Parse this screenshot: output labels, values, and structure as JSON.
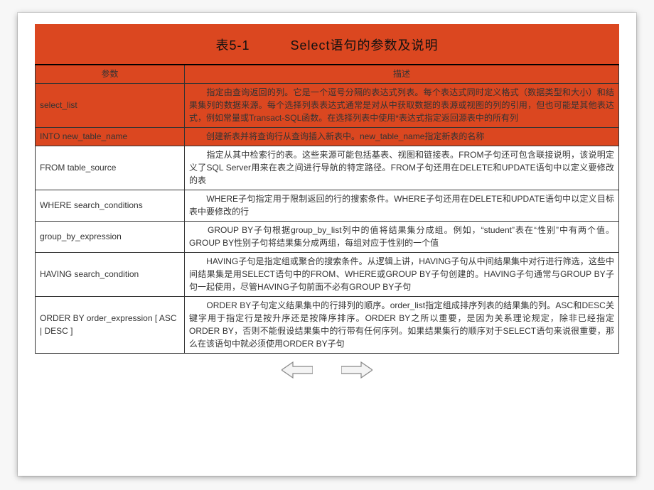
{
  "title": "表5-1　　　Select语句的参数及说明",
  "headers": {
    "param": "参数",
    "desc": "描述"
  },
  "rows": [
    {
      "param": "select_list",
      "orange": true,
      "desc": "　　指定由查询返回的列。它是一个逗号分隔的表达式列表。每个表达式同时定义格式（数据类型和大小）和结果集列的数据来源。每个选择列表表达式通常是对从中获取数据的表源或视图的列的引用，但也可能是其他表达式，例如常量或Transact-SQL函数。在选择列表中使用*表达式指定返回源表中的所有列"
    },
    {
      "param": "INTO new_table_name",
      "orange": true,
      "desc": "　　创建新表并将查询行从查询插入新表中。new_table_name指定新表的名称"
    },
    {
      "param": "FROM table_source",
      "orange": false,
      "desc": "　　指定从其中检索行的表。这些来源可能包括基表、视图和链接表。FROM子句还可包含联接说明，该说明定义了SQL Server用来在表之间进行导航的特定路径。FROM子句还用在DELETE和UPDATE语句中以定义要修改的表"
    },
    {
      "param": "WHERE  search_conditions",
      "orange": false,
      "desc": "　　WHERE子句指定用于限制返回的行的搜索条件。WHERE子句还用在DELETE和UPDATE语句中以定义目标表中要修改的行"
    },
    {
      "param": "group_by_expression",
      "orange": false,
      "desc": "　　GROUP BY子句根据group_by_list列中的值将结果集分成组。例如，“student”表在“性别”中有两个值。GROUP BY性别子句将结果集分成两组，每组对应于性别的一个值"
    },
    {
      "param": "HAVING search_condition",
      "orange": false,
      "desc": "　　HAVING子句是指定组或聚合的搜索条件。从逻辑上讲，HAVING子句从中间结果集中对行进行筛选，这些中间结果集是用SELECT语句中的FROM、WHERE或GROUP BY子句创建的。HAVING子句通常与GROUP BY子句一起使用，尽管HAVING子句前面不必有GROUP BY子句"
    },
    {
      "param": "ORDER BY order_expression [ ASC | DESC ]",
      "orange": false,
      "desc": "　　ORDER BY子句定义结果集中的行排列的顺序。order_list指定组成排序列表的结果集的列。ASC和DESC关键字用于指定行是按升序还是按降序排序。ORDER BY之所以重要，是因为关系理论规定，除非已经指定ORDER BY，否则不能假设结果集中的行带有任何序列。如果结果集行的顺序对于SELECT语句来说很重要，那么在该语句中就必须使用ORDER BY子句"
    }
  ],
  "nav": {
    "prev": "prev-arrow",
    "next": "next-arrow"
  }
}
